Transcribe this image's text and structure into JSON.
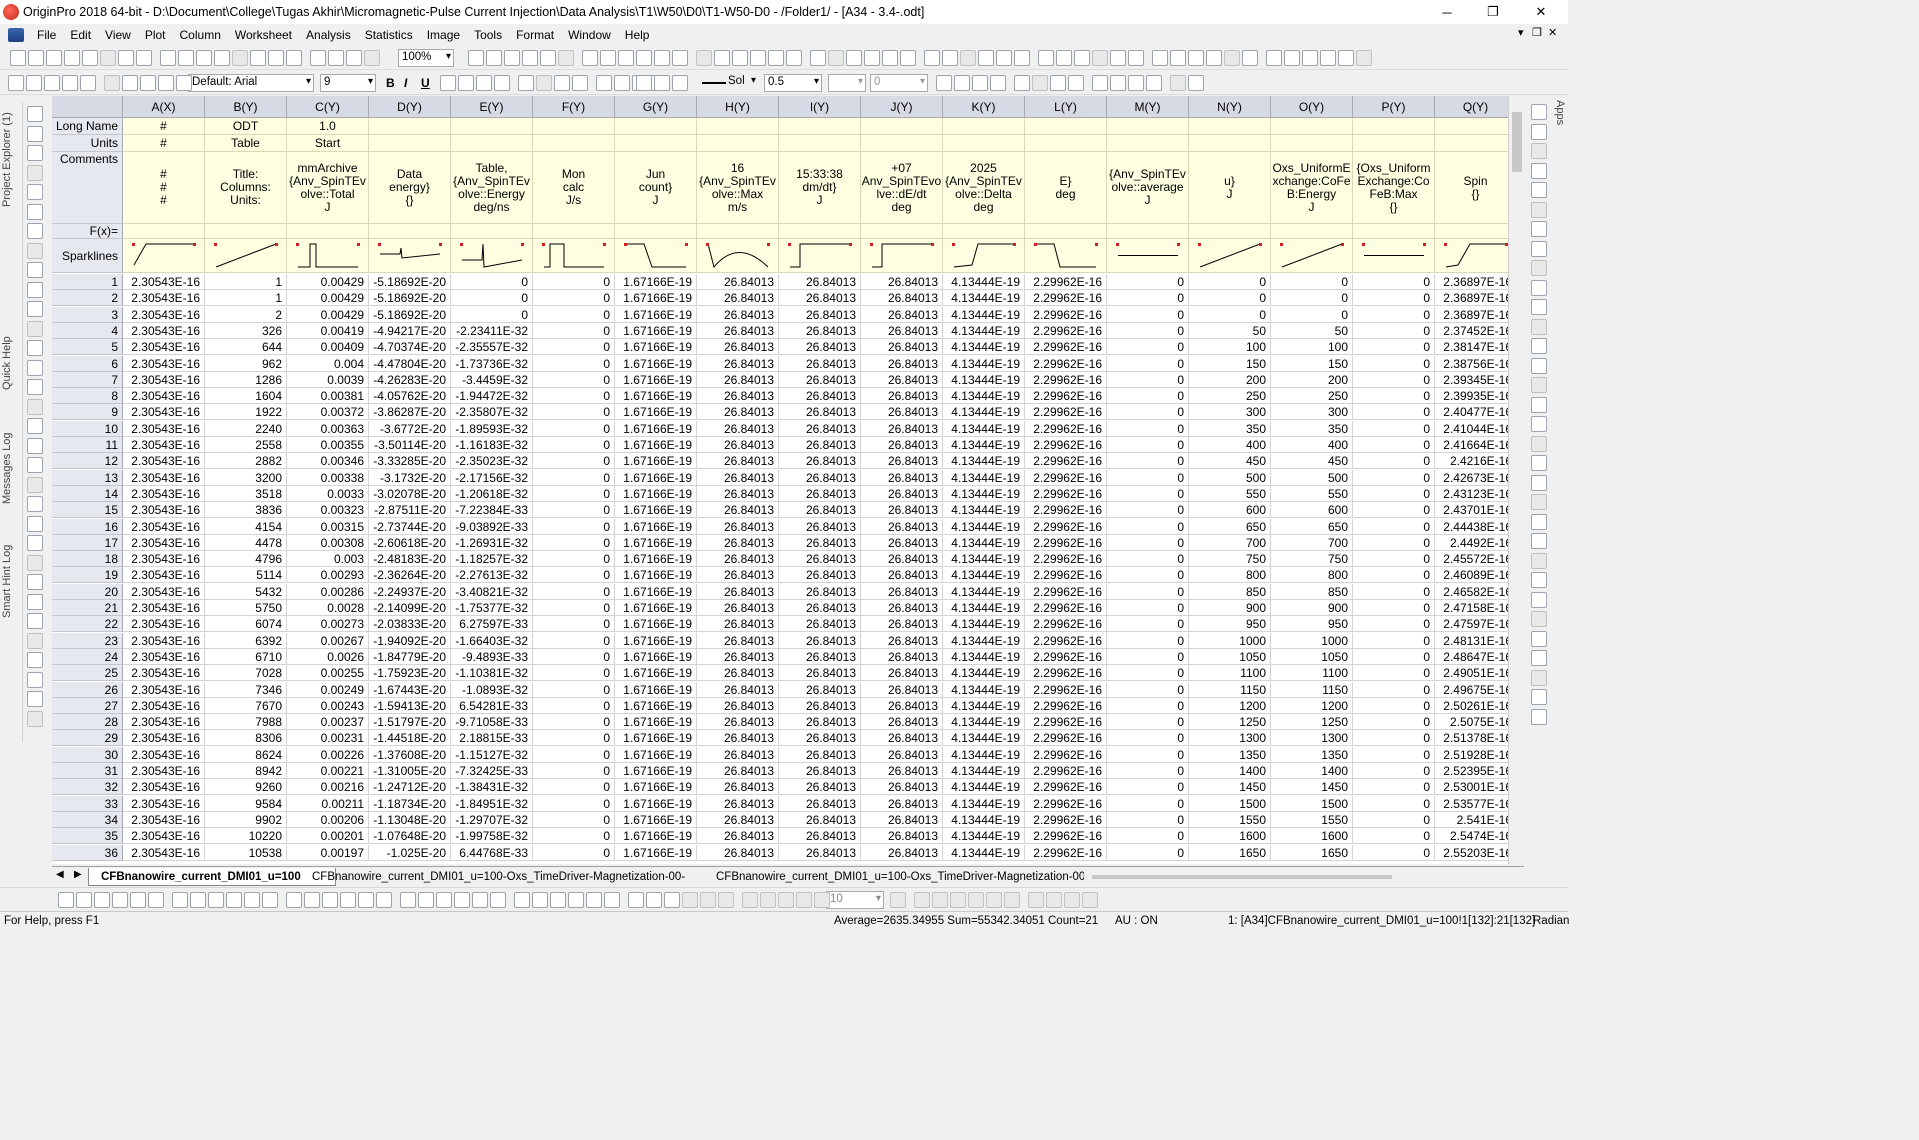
{
  "window": {
    "title": "OriginPro 2018 64-bit - D:\\Document\\College\\Tugas Akhir\\Micromagnetic-Pulse Current Injection\\Data Analysis\\T1\\W50\\D0\\T1-W50-D0 - /Folder1/ - [A34 - 3.4-.odt]",
    "minimize": "─",
    "maximize": "❐",
    "close": "✕"
  },
  "menu": [
    "File",
    "Edit",
    "View",
    "Plot",
    "Column",
    "Worksheet",
    "Analysis",
    "Statistics",
    "Image",
    "Tools",
    "Format",
    "Window",
    "Help"
  ],
  "mdi_controls": [
    "▾",
    "❐",
    "✕"
  ],
  "toolbar": {
    "zoom": "100%",
    "font": "Default: Arial",
    "font_size": "9",
    "bold": "B",
    "italic": "I",
    "underline": "U",
    "line_style": "Sol",
    "line_width": "0.5",
    "pattern_value": "0",
    "bottom_size": "10"
  },
  "side_tabs": [
    "Project Explorer (1)",
    "Quick Help",
    "Messages Log",
    "Smart Hint Log"
  ],
  "right_tab": "Apps",
  "sheet": {
    "corner": "",
    "columns": [
      "A(X)",
      "B(Y)",
      "C(Y)",
      "D(Y)",
      "E(Y)",
      "F(Y)",
      "G(Y)",
      "H(Y)",
      "I(Y)",
      "J(Y)",
      "K(Y)",
      "L(Y)",
      "M(Y)",
      "N(Y)",
      "O(Y)",
      "P(Y)",
      "Q(Y)"
    ],
    "row_labels": {
      "long_name": "Long Name",
      "units": "Units",
      "comments": "Comments",
      "fx": "F(x)=",
      "sparklines": "Sparklines"
    },
    "long_name": [
      "#",
      "ODT",
      "1.0",
      "",
      "",
      "",
      "",
      "",
      "",
      "",
      "",
      "",
      "",
      "",
      "",
      "",
      ""
    ],
    "units": [
      "#",
      "Table",
      "Start",
      "",
      "",
      "",
      "",
      "",
      "",
      "",
      "",
      "",
      "",
      "",
      "",
      "",
      ""
    ],
    "comments": [
      "#\n#\n#",
      "Title:\nColumns:\nUnits:",
      "mmArchive\n{Anv_SpinTEv\nolve::Total\nJ",
      "Data\nenergy}\n{}",
      "Table,\n{Anv_SpinTEv\nolve::Energy\ndeg/ns",
      "Mon\ncalc\nJ/s",
      "Jun\ncount}\nJ",
      "16\n{Anv_SpinTEv\nolve::Max\nm/s",
      "15:33:38\ndm/dt}\nJ",
      "+07\nAnv_SpinTEvo\nlve::dE/dt\ndeg",
      "2025\n{Anv_SpinTEv\nolve::Delta\ndeg",
      "E}\ndeg",
      "{Anv_SpinTEv\nolve::average\nJ",
      "u}\nJ",
      "Oxs_UniformE\nxchange:CoFe\nB:Energy\nJ",
      "{Oxs_Uniform\nExchange:Co\nFeB:Max\n{}",
      "Spin\n{}"
    ],
    "rows": [
      [
        "1",
        "2.30543E-16",
        "1",
        "0.00429",
        "-5.18692E-20",
        "0",
        "0",
        "1.67166E-19",
        "26.84013",
        "26.84013",
        "26.84013",
        "4.13444E-19",
        "2.29962E-16",
        "0",
        "0",
        "0",
        "0",
        "2.36897E-16"
      ],
      [
        "2",
        "2.30543E-16",
        "1",
        "0.00429",
        "-5.18692E-20",
        "0",
        "0",
        "1.67166E-19",
        "26.84013",
        "26.84013",
        "26.84013",
        "4.13444E-19",
        "2.29962E-16",
        "0",
        "0",
        "0",
        "0",
        "2.36897E-16"
      ],
      [
        "3",
        "2.30543E-16",
        "2",
        "0.00429",
        "-5.18692E-20",
        "0",
        "0",
        "1.67166E-19",
        "26.84013",
        "26.84013",
        "26.84013",
        "4.13444E-19",
        "2.29962E-16",
        "0",
        "0",
        "0",
        "0",
        "2.36897E-16"
      ],
      [
        "4",
        "2.30543E-16",
        "326",
        "0.00419",
        "-4.94217E-20",
        "-2.23411E-32",
        "0",
        "1.67166E-19",
        "26.84013",
        "26.84013",
        "26.84013",
        "4.13444E-19",
        "2.29962E-16",
        "0",
        "50",
        "50",
        "0",
        "2.37452E-16"
      ],
      [
        "5",
        "2.30543E-16",
        "644",
        "0.00409",
        "-4.70374E-20",
        "-2.35557E-32",
        "0",
        "1.67166E-19",
        "26.84013",
        "26.84013",
        "26.84013",
        "4.13444E-19",
        "2.29962E-16",
        "0",
        "100",
        "100",
        "0",
        "2.38147E-16"
      ],
      [
        "6",
        "2.30543E-16",
        "962",
        "0.004",
        "-4.47804E-20",
        "-1.73736E-32",
        "0",
        "1.67166E-19",
        "26.84013",
        "26.84013",
        "26.84013",
        "4.13444E-19",
        "2.29962E-16",
        "0",
        "150",
        "150",
        "0",
        "2.38756E-16"
      ],
      [
        "7",
        "2.30543E-16",
        "1286",
        "0.0039",
        "-4.26283E-20",
        "-3.4459E-32",
        "0",
        "1.67166E-19",
        "26.84013",
        "26.84013",
        "26.84013",
        "4.13444E-19",
        "2.29962E-16",
        "0",
        "200",
        "200",
        "0",
        "2.39345E-16"
      ],
      [
        "8",
        "2.30543E-16",
        "1604",
        "0.00381",
        "-4.05762E-20",
        "-1.94472E-32",
        "0",
        "1.67166E-19",
        "26.84013",
        "26.84013",
        "26.84013",
        "4.13444E-19",
        "2.29962E-16",
        "0",
        "250",
        "250",
        "0",
        "2.39935E-16"
      ],
      [
        "9",
        "2.30543E-16",
        "1922",
        "0.00372",
        "-3.86287E-20",
        "-2.35807E-32",
        "0",
        "1.67166E-19",
        "26.84013",
        "26.84013",
        "26.84013",
        "4.13444E-19",
        "2.29962E-16",
        "0",
        "300",
        "300",
        "0",
        "2.40477E-16"
      ],
      [
        "10",
        "2.30543E-16",
        "2240",
        "0.00363",
        "-3.6772E-20",
        "-1.89593E-32",
        "0",
        "1.67166E-19",
        "26.84013",
        "26.84013",
        "26.84013",
        "4.13444E-19",
        "2.29962E-16",
        "0",
        "350",
        "350",
        "0",
        "2.41044E-16"
      ],
      [
        "11",
        "2.30543E-16",
        "2558",
        "0.00355",
        "-3.50114E-20",
        "-1.16183E-32",
        "0",
        "1.67166E-19",
        "26.84013",
        "26.84013",
        "26.84013",
        "4.13444E-19",
        "2.29962E-16",
        "0",
        "400",
        "400",
        "0",
        "2.41664E-16"
      ],
      [
        "12",
        "2.30543E-16",
        "2882",
        "0.00346",
        "-3.33285E-20",
        "-2.35023E-32",
        "0",
        "1.67166E-19",
        "26.84013",
        "26.84013",
        "26.84013",
        "4.13444E-19",
        "2.29962E-16",
        "0",
        "450",
        "450",
        "0",
        "2.4216E-16"
      ],
      [
        "13",
        "2.30543E-16",
        "3200",
        "0.00338",
        "-3.1732E-20",
        "-2.17156E-32",
        "0",
        "1.67166E-19",
        "26.84013",
        "26.84013",
        "26.84013",
        "4.13444E-19",
        "2.29962E-16",
        "0",
        "500",
        "500",
        "0",
        "2.42673E-16"
      ],
      [
        "14",
        "2.30543E-16",
        "3518",
        "0.0033",
        "-3.02078E-20",
        "-1.20618E-32",
        "0",
        "1.67166E-19",
        "26.84013",
        "26.84013",
        "26.84013",
        "4.13444E-19",
        "2.29962E-16",
        "0",
        "550",
        "550",
        "0",
        "2.43123E-16"
      ],
      [
        "15",
        "2.30543E-16",
        "3836",
        "0.00323",
        "-2.87511E-20",
        "-7.22384E-33",
        "0",
        "1.67166E-19",
        "26.84013",
        "26.84013",
        "26.84013",
        "4.13444E-19",
        "2.29962E-16",
        "0",
        "600",
        "600",
        "0",
        "2.43701E-16"
      ],
      [
        "16",
        "2.30543E-16",
        "4154",
        "0.00315",
        "-2.73744E-20",
        "-9.03892E-33",
        "0",
        "1.67166E-19",
        "26.84013",
        "26.84013",
        "26.84013",
        "4.13444E-19",
        "2.29962E-16",
        "0",
        "650",
        "650",
        "0",
        "2.44438E-16"
      ],
      [
        "17",
        "2.30543E-16",
        "4478",
        "0.00308",
        "-2.60618E-20",
        "-1.26931E-32",
        "0",
        "1.67166E-19",
        "26.84013",
        "26.84013",
        "26.84013",
        "4.13444E-19",
        "2.29962E-16",
        "0",
        "700",
        "700",
        "0",
        "2.4492E-16"
      ],
      [
        "18",
        "2.30543E-16",
        "4796",
        "0.003",
        "-2.48183E-20",
        "-1.18257E-32",
        "0",
        "1.67166E-19",
        "26.84013",
        "26.84013",
        "26.84013",
        "4.13444E-19",
        "2.29962E-16",
        "0",
        "750",
        "750",
        "0",
        "2.45572E-16"
      ],
      [
        "19",
        "2.30543E-16",
        "5114",
        "0.00293",
        "-2.36264E-20",
        "-2.27613E-32",
        "0",
        "1.67166E-19",
        "26.84013",
        "26.84013",
        "26.84013",
        "4.13444E-19",
        "2.29962E-16",
        "0",
        "800",
        "800",
        "0",
        "2.46089E-16"
      ],
      [
        "20",
        "2.30543E-16",
        "5432",
        "0.00286",
        "-2.24937E-20",
        "-3.40821E-32",
        "0",
        "1.67166E-19",
        "26.84013",
        "26.84013",
        "26.84013",
        "4.13444E-19",
        "2.29962E-16",
        "0",
        "850",
        "850",
        "0",
        "2.46582E-16"
      ],
      [
        "21",
        "2.30543E-16",
        "5750",
        "0.0028",
        "-2.14099E-20",
        "-1.75377E-32",
        "0",
        "1.67166E-19",
        "26.84013",
        "26.84013",
        "26.84013",
        "4.13444E-19",
        "2.29962E-16",
        "0",
        "900",
        "900",
        "0",
        "2.47158E-16"
      ],
      [
        "22",
        "2.30543E-16",
        "6074",
        "0.00273",
        "-2.03833E-20",
        "6.27597E-33",
        "0",
        "1.67166E-19",
        "26.84013",
        "26.84013",
        "26.84013",
        "4.13444E-19",
        "2.29962E-16",
        "0",
        "950",
        "950",
        "0",
        "2.47597E-16"
      ],
      [
        "23",
        "2.30543E-16",
        "6392",
        "0.00267",
        "-1.94092E-20",
        "-1.66403E-32",
        "0",
        "1.67166E-19",
        "26.84013",
        "26.84013",
        "26.84013",
        "4.13444E-19",
        "2.29962E-16",
        "0",
        "1000",
        "1000",
        "0",
        "2.48131E-16"
      ],
      [
        "24",
        "2.30543E-16",
        "6710",
        "0.0026",
        "-1.84779E-20",
        "-9.4893E-33",
        "0",
        "1.67166E-19",
        "26.84013",
        "26.84013",
        "26.84013",
        "4.13444E-19",
        "2.29962E-16",
        "0",
        "1050",
        "1050",
        "0",
        "2.48647E-16"
      ],
      [
        "25",
        "2.30543E-16",
        "7028",
        "0.00255",
        "-1.75923E-20",
        "-1.10381E-32",
        "0",
        "1.67166E-19",
        "26.84013",
        "26.84013",
        "26.84013",
        "4.13444E-19",
        "2.29962E-16",
        "0",
        "1100",
        "1100",
        "0",
        "2.49051E-16"
      ],
      [
        "26",
        "2.30543E-16",
        "7346",
        "0.00249",
        "-1.67443E-20",
        "-1.0893E-32",
        "0",
        "1.67166E-19",
        "26.84013",
        "26.84013",
        "26.84013",
        "4.13444E-19",
        "2.29962E-16",
        "0",
        "1150",
        "1150",
        "0",
        "2.49675E-16"
      ],
      [
        "27",
        "2.30543E-16",
        "7670",
        "0.00243",
        "-1.59413E-20",
        "6.54281E-33",
        "0",
        "1.67166E-19",
        "26.84013",
        "26.84013",
        "26.84013",
        "4.13444E-19",
        "2.29962E-16",
        "0",
        "1200",
        "1200",
        "0",
        "2.50261E-16"
      ],
      [
        "28",
        "2.30543E-16",
        "7988",
        "0.00237",
        "-1.51797E-20",
        "-9.71058E-33",
        "0",
        "1.67166E-19",
        "26.84013",
        "26.84013",
        "26.84013",
        "4.13444E-19",
        "2.29962E-16",
        "0",
        "1250",
        "1250",
        "0",
        "2.5075E-16"
      ],
      [
        "29",
        "2.30543E-16",
        "8306",
        "0.00231",
        "-1.44518E-20",
        "2.18815E-33",
        "0",
        "1.67166E-19",
        "26.84013",
        "26.84013",
        "26.84013",
        "4.13444E-19",
        "2.29962E-16",
        "0",
        "1300",
        "1300",
        "0",
        "2.51378E-16"
      ],
      [
        "30",
        "2.30543E-16",
        "8624",
        "0.00226",
        "-1.37608E-20",
        "-1.15127E-32",
        "0",
        "1.67166E-19",
        "26.84013",
        "26.84013",
        "26.84013",
        "4.13444E-19",
        "2.29962E-16",
        "0",
        "1350",
        "1350",
        "0",
        "2.51928E-16"
      ],
      [
        "31",
        "2.30543E-16",
        "8942",
        "0.00221",
        "-1.31005E-20",
        "-7.32425E-33",
        "0",
        "1.67166E-19",
        "26.84013",
        "26.84013",
        "26.84013",
        "4.13444E-19",
        "2.29962E-16",
        "0",
        "1400",
        "1400",
        "0",
        "2.52395E-16"
      ],
      [
        "32",
        "2.30543E-16",
        "9260",
        "0.00216",
        "-1.24712E-20",
        "-1.38431E-32",
        "0",
        "1.67166E-19",
        "26.84013",
        "26.84013",
        "26.84013",
        "4.13444E-19",
        "2.29962E-16",
        "0",
        "1450",
        "1450",
        "0",
        "2.53001E-16"
      ],
      [
        "33",
        "2.30543E-16",
        "9584",
        "0.00211",
        "-1.18734E-20",
        "-1.84951E-32",
        "0",
        "1.67166E-19",
        "26.84013",
        "26.84013",
        "26.84013",
        "4.13444E-19",
        "2.29962E-16",
        "0",
        "1500",
        "1500",
        "0",
        "2.53577E-16"
      ],
      [
        "34",
        "2.30543E-16",
        "9902",
        "0.00206",
        "-1.13048E-20",
        "-1.29707E-32",
        "0",
        "1.67166E-19",
        "26.84013",
        "26.84013",
        "26.84013",
        "4.13444E-19",
        "2.29962E-16",
        "0",
        "1550",
        "1550",
        "0",
        "2.541E-16"
      ],
      [
        "35",
        "2.30543E-16",
        "10220",
        "0.00201",
        "-1.07648E-20",
        "-1.99758E-32",
        "0",
        "1.67166E-19",
        "26.84013",
        "26.84013",
        "26.84013",
        "4.13444E-19",
        "2.29962E-16",
        "0",
        "1600",
        "1600",
        "0",
        "2.5474E-16"
      ],
      [
        "36",
        "2.30543E-16",
        "10538",
        "0.00197",
        "-1.025E-20",
        "6.44768E-33",
        "0",
        "1.67166E-19",
        "26.84013",
        "26.84013",
        "26.84013",
        "4.13444E-19",
        "2.29962E-16",
        "0",
        "1650",
        "1650",
        "0",
        "2.55203E-16"
      ]
    ]
  },
  "sheet_tabs": [
    "CFBnanowire_current_DMI01_u=100",
    "CFBnanowire_current_DMI01_u=100-Oxs_TimeDriver-Magnetization-00-",
    "CFBnanowire_current_DMI01_u=100-Oxs_TimeDriver-Magnetization-00"
  ],
  "status": {
    "help": "For Help, press F1",
    "stats": "Average=2635.34955 Sum=55342.34051 Count=21",
    "au": "AU : ON",
    "location": "1: [A34]CFBnanowire_current_DMI01_u=100!1[132]:21[132]",
    "angle": "Radian"
  },
  "colors": {
    "header_bg": "#d7dae4",
    "label_bg": "#fefee0",
    "row_header_bg": "#e6e8ef",
    "sparkline_red": "#d21e1e"
  }
}
